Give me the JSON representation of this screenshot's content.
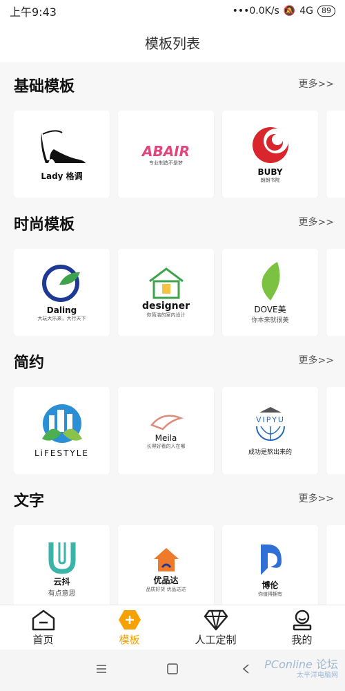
{
  "status_bar": {
    "time": "上午9:43",
    "speed": "•••0.0K/s",
    "network": "4G",
    "battery": "89"
  },
  "header": {
    "title": "模板列表"
  },
  "sections": [
    {
      "title": "基础模板",
      "more": "更多>>",
      "cards": [
        {
          "name": "Lady 格调",
          "sub": ""
        },
        {
          "name": "ABAIR",
          "sub": "专业制造不是梦"
        },
        {
          "name": "BUBY",
          "sub": "朗朗书院"
        }
      ]
    },
    {
      "title": "时尚模板",
      "more": "更多>>",
      "cards": [
        {
          "name": "Daling",
          "sub": "大玩大乐来，大行天下"
        },
        {
          "name": "designer",
          "sub": "你简洁的室内设计"
        },
        {
          "name": "DOVE美",
          "sub": "你本来就很美"
        }
      ]
    },
    {
      "title": "简约",
      "more": "更多>>",
      "cards": [
        {
          "name": "LiFESTYLE",
          "sub": ""
        },
        {
          "name": "Meila",
          "sub": "长得好看的人在哪"
        },
        {
          "name": "VIPYU",
          "sub": "成功是熬出来的"
        }
      ]
    },
    {
      "title": "文字",
      "more": "更多>>",
      "cards": [
        {
          "name": "云抖",
          "sub": "有点意思"
        },
        {
          "name": "优品达",
          "sub": "品质好货 优品达达"
        },
        {
          "name": "博伦",
          "sub": "你值得拥有"
        }
      ]
    }
  ],
  "nav": [
    {
      "label": "首页",
      "icon": "home-icon"
    },
    {
      "label": "模板",
      "icon": "plus-hexagon-icon"
    },
    {
      "label": "人工定制",
      "icon": "diamond-icon"
    },
    {
      "label": "我的",
      "icon": "user-icon"
    }
  ],
  "watermark": {
    "brand": "PConline",
    "sub": "太平洋电脑网",
    "forum": "论坛"
  },
  "colors": {
    "accent": "#f5a100",
    "background": "#f7f7f7"
  }
}
